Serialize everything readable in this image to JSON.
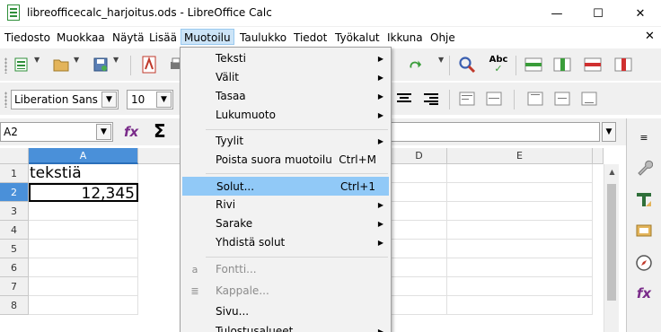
{
  "window": {
    "title": "libreofficecalc_harjoitus.ods - LibreOffice Calc",
    "minimize": "—",
    "maximize": "☐",
    "close": "✕"
  },
  "menubar": {
    "items": [
      "Tiedosto",
      "Muokkaa",
      "Näytä",
      "Lisää",
      "Muotoilu",
      "Taulukko",
      "Tiedot",
      "Työkalut",
      "Ikkuna",
      "Ohje"
    ],
    "active": "Muotoilu",
    "close_doc": "✕"
  },
  "formatting": {
    "font_name": "Liberation Sans",
    "font_size": "10"
  },
  "formula_bar": {
    "name_box": "A2",
    "fx": "fx",
    "sigma": "Σ",
    "content": ""
  },
  "grid": {
    "columns": [
      "A",
      "D",
      "E"
    ],
    "rows": [
      "1",
      "2",
      "3",
      "4",
      "5",
      "6",
      "7",
      "8"
    ],
    "cells": {
      "A1": "tekstiä",
      "A2": "12,345"
    },
    "selected_cell": "A2"
  },
  "format_menu": {
    "items": [
      {
        "label": "Teksti",
        "submenu": true
      },
      {
        "label": "Välit",
        "submenu": true
      },
      {
        "label": "Tasaa",
        "submenu": true
      },
      {
        "label": "Lukumuoto",
        "submenu": true
      },
      {
        "label": "Tyylit",
        "submenu": true
      },
      {
        "label": "Poista suora muotoilu",
        "shortcut": "Ctrl+M"
      },
      {
        "label": "Solut...",
        "shortcut": "Ctrl+1",
        "highlighted": true
      },
      {
        "label": "Rivi",
        "submenu": true
      },
      {
        "label": "Sarake",
        "submenu": true
      },
      {
        "label": "Yhdistä solut",
        "submenu": true
      },
      {
        "label": "Fontti...",
        "disabled": true
      },
      {
        "label": "Kappale...",
        "disabled": true
      },
      {
        "label": "Sivu..."
      },
      {
        "label": "Tulostusalueet",
        "submenu": true
      }
    ]
  },
  "colors": {
    "menu_highlight": "#91c9f7",
    "header_selected": "#4a90d9",
    "active_menu": "#cce4f7"
  }
}
